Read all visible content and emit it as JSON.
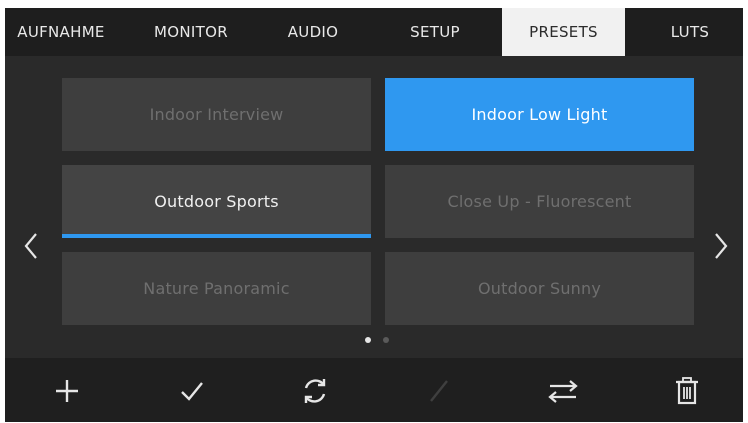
{
  "tabs": [
    {
      "label": "AUFNAHME",
      "active": false
    },
    {
      "label": "MONITOR",
      "active": false
    },
    {
      "label": "AUDIO",
      "active": false
    },
    {
      "label": "SETUP",
      "active": false
    },
    {
      "label": "PRESETS",
      "active": true
    },
    {
      "label": "LUTS",
      "active": false
    }
  ],
  "presets": [
    {
      "label": "Indoor Interview",
      "state": "inactive"
    },
    {
      "label": "Indoor Low Light",
      "state": "selected"
    },
    {
      "label": "Outdoor Sports",
      "state": "focused"
    },
    {
      "label": "Close Up - Fluorescent",
      "state": "inactive"
    },
    {
      "label": "Nature Panoramic",
      "state": "inactive"
    },
    {
      "label": "Outdoor Sunny",
      "state": "inactive"
    }
  ],
  "pagination": {
    "pages": 2,
    "current": 1
  },
  "toolbar": [
    {
      "icon": "plus-icon",
      "enabled": true
    },
    {
      "icon": "checkmark-icon",
      "enabled": true
    },
    {
      "icon": "refresh-icon",
      "enabled": true
    },
    {
      "icon": "pencil-icon",
      "enabled": false
    },
    {
      "icon": "swap-arrows-icon",
      "enabled": true
    },
    {
      "icon": "trash-icon",
      "enabled": true
    }
  ],
  "colors": {
    "accent": "#2f98f0",
    "tile": "#3e3e3e",
    "background": "#2a2a2a"
  }
}
